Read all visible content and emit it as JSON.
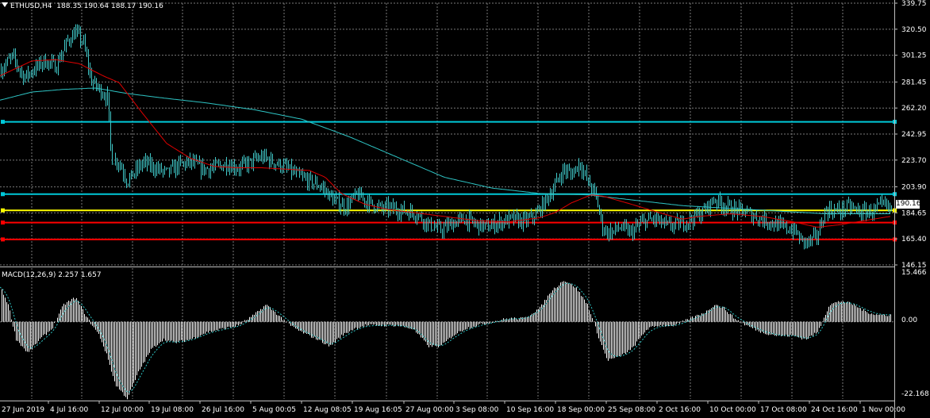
{
  "header": {
    "symbol_tf": "ETHUSD,H4",
    "ohlc": "188.35 190.64 188.17 190.16"
  },
  "current_price": "190.16",
  "price_axis": {
    "ticks": [
      "339.75",
      "320.50",
      "301.25",
      "281.45",
      "262.20",
      "242.95",
      "223.70",
      "203.90",
      "184.65",
      "165.40",
      "146.15"
    ],
    "min": 146.15,
    "max": 339.75
  },
  "time_axis": {
    "labels": [
      "27 Jun 2019",
      "4 Jul 16:00",
      "12 Jul 00:00",
      "19 Jul 08:00",
      "26 Jul 16:00",
      "5 Aug 00:05",
      "12 Aug 08:05",
      "19 Aug 16:05",
      "27 Aug 00:00",
      "3 Sep 08:00",
      "10 Sep 16:00",
      "18 Sep 00:00",
      "25 Sep 08:00",
      "2 Oct 16:00",
      "10 Oct 00:00",
      "17 Oct 08:00",
      "24 Oct 16:00",
      "1 Nov 00:00"
    ]
  },
  "macd": {
    "label": "MACD(12,26,9) 2.257 1.657",
    "ticks": [
      "15.466",
      "0.00",
      "-22.168"
    ],
    "min": -22.168,
    "max": 15.466
  },
  "horizontal_levels": [
    {
      "price": 252.0,
      "color": "#00c8d8"
    },
    {
      "price": 198.5,
      "color": "#00c8d8"
    },
    {
      "price": 186.5,
      "color": "#ffff00"
    },
    {
      "price": 177.5,
      "color": "#ff0000"
    },
    {
      "price": 165.0,
      "color": "#ff0000"
    }
  ],
  "colors": {
    "background": "#000000",
    "grid": "#7a7a7a",
    "candle": "#40c8c8",
    "ma_fast": "#e00000",
    "ma_slow": "#2ec4c4",
    "macd_hist": "#ffffff",
    "macd_signal": "#2ec4c4"
  },
  "chart_data": {
    "type": "candlestick",
    "price_anchors": [
      [
        0,
        290
      ],
      [
        15,
        300
      ],
      [
        30,
        285
      ],
      [
        45,
        292
      ],
      [
        55,
        297
      ],
      [
        70,
        293
      ],
      [
        85,
        312
      ],
      [
        95,
        318
      ],
      [
        105,
        310
      ],
      [
        115,
        282
      ],
      [
        125,
        276
      ],
      [
        135,
        270
      ],
      [
        140,
        225
      ],
      [
        150,
        222
      ],
      [
        160,
        208
      ],
      [
        170,
        215
      ],
      [
        180,
        222
      ],
      [
        195,
        218
      ],
      [
        210,
        214
      ],
      [
        225,
        220
      ],
      [
        240,
        222
      ],
      [
        255,
        217
      ],
      [
        270,
        218
      ],
      [
        285,
        221
      ],
      [
        300,
        218
      ],
      [
        315,
        222
      ],
      [
        330,
        226
      ],
      [
        345,
        222
      ],
      [
        360,
        218
      ],
      [
        375,
        212
      ],
      [
        390,
        208
      ],
      [
        405,
        204
      ],
      [
        420,
        194
      ],
      [
        435,
        189
      ],
      [
        450,
        198
      ],
      [
        465,
        192
      ],
      [
        480,
        188
      ],
      [
        495,
        188
      ],
      [
        510,
        186
      ],
      [
        525,
        184
      ],
      [
        540,
        176
      ],
      [
        555,
        172
      ],
      [
        570,
        177
      ],
      [
        585,
        180
      ],
      [
        600,
        176
      ],
      [
        615,
        174
      ],
      [
        630,
        178
      ],
      [
        645,
        180
      ],
      [
        660,
        178
      ],
      [
        675,
        183
      ],
      [
        690,
        196
      ],
      [
        700,
        206
      ],
      [
        710,
        217
      ],
      [
        720,
        213
      ],
      [
        730,
        222
      ],
      [
        740,
        208
      ],
      [
        750,
        198
      ],
      [
        760,
        172
      ],
      [
        770,
        170
      ],
      [
        780,
        174
      ],
      [
        795,
        170
      ],
      [
        810,
        178
      ],
      [
        825,
        180
      ],
      [
        840,
        175
      ],
      [
        855,
        176
      ],
      [
        870,
        180
      ],
      [
        885,
        185
      ],
      [
        900,
        195
      ],
      [
        912,
        190
      ],
      [
        925,
        187
      ],
      [
        940,
        185
      ],
      [
        955,
        181
      ],
      [
        970,
        178
      ],
      [
        985,
        174
      ],
      [
        1000,
        172
      ],
      [
        1010,
        164
      ],
      [
        1020,
        163
      ],
      [
        1030,
        168
      ],
      [
        1040,
        187
      ],
      [
        1055,
        186
      ],
      [
        1070,
        189
      ],
      [
        1085,
        185
      ],
      [
        1100,
        186
      ],
      [
        1112,
        190
      ],
      [
        1122,
        188
      ]
    ],
    "ma_fast_anchors": [
      [
        0,
        286
      ],
      [
        40,
        297
      ],
      [
        70,
        298
      ],
      [
        100,
        295
      ],
      [
        130,
        286
      ],
      [
        150,
        281
      ],
      [
        180,
        258
      ],
      [
        210,
        236
      ],
      [
        240,
        225
      ],
      [
        270,
        219
      ],
      [
        300,
        218
      ],
      [
        330,
        218
      ],
      [
        360,
        217
      ],
      [
        390,
        216
      ],
      [
        410,
        211
      ],
      [
        430,
        199
      ],
      [
        460,
        191
      ],
      [
        490,
        187
      ],
      [
        520,
        185
      ],
      [
        560,
        182
      ],
      [
        600,
        179
      ],
      [
        640,
        178
      ],
      [
        680,
        181
      ],
      [
        700,
        185
      ],
      [
        720,
        192
      ],
      [
        745,
        198
      ],
      [
        760,
        197
      ],
      [
        790,
        192
      ],
      [
        830,
        185
      ],
      [
        860,
        180
      ],
      [
        880,
        182
      ],
      [
        920,
        184
      ],
      [
        960,
        182
      ],
      [
        1000,
        178
      ],
      [
        1030,
        174
      ],
      [
        1060,
        176
      ],
      [
        1100,
        180
      ],
      [
        1122,
        182
      ]
    ],
    "ma_slow_anchors": [
      [
        0,
        268
      ],
      [
        40,
        274
      ],
      [
        80,
        276
      ],
      [
        120,
        277
      ],
      [
        160,
        273
      ],
      [
        200,
        270
      ],
      [
        260,
        266
      ],
      [
        320,
        261
      ],
      [
        380,
        254
      ],
      [
        440,
        241
      ],
      [
        500,
        226
      ],
      [
        560,
        211
      ],
      [
        620,
        203
      ],
      [
        680,
        199
      ],
      [
        740,
        198
      ],
      [
        800,
        194
      ],
      [
        860,
        190
      ],
      [
        920,
        188
      ],
      [
        980,
        186
      ],
      [
        1040,
        184
      ],
      [
        1100,
        184
      ],
      [
        1122,
        184
      ]
    ],
    "macd_anchors": [
      [
        0,
        10
      ],
      [
        10,
        5
      ],
      [
        20,
        -5
      ],
      [
        35,
        -9
      ],
      [
        50,
        -5
      ],
      [
        65,
        -2
      ],
      [
        80,
        5
      ],
      [
        95,
        7
      ],
      [
        110,
        1
      ],
      [
        125,
        -4
      ],
      [
        135,
        -10
      ],
      [
        145,
        -18
      ],
      [
        160,
        -22
      ],
      [
        175,
        -14
      ],
      [
        190,
        -8
      ],
      [
        205,
        -5
      ],
      [
        220,
        -6
      ],
      [
        240,
        -5
      ],
      [
        260,
        -3
      ],
      [
        280,
        -2
      ],
      [
        300,
        -1
      ],
      [
        320,
        2
      ],
      [
        335,
        5
      ],
      [
        350,
        2
      ],
      [
        365,
        -1
      ],
      [
        380,
        -3
      ],
      [
        400,
        -5
      ],
      [
        415,
        -7
      ],
      [
        430,
        -4
      ],
      [
        445,
        -2
      ],
      [
        460,
        -1
      ],
      [
        480,
        -1
      ],
      [
        500,
        -1
      ],
      [
        520,
        -2
      ],
      [
        540,
        -7
      ],
      [
        555,
        -7
      ],
      [
        570,
        -4
      ],
      [
        585,
        -2
      ],
      [
        600,
        -1
      ],
      [
        620,
        0
      ],
      [
        640,
        1
      ],
      [
        660,
        1
      ],
      [
        680,
        4
      ],
      [
        695,
        9
      ],
      [
        710,
        12
      ],
      [
        725,
        10
      ],
      [
        740,
        5
      ],
      [
        755,
        -5
      ],
      [
        765,
        -11
      ],
      [
        780,
        -10
      ],
      [
        795,
        -8
      ],
      [
        805,
        -5
      ],
      [
        815,
        -2
      ],
      [
        830,
        -1
      ],
      [
        850,
        -1
      ],
      [
        870,
        1
      ],
      [
        890,
        3
      ],
      [
        900,
        5
      ],
      [
        912,
        4
      ],
      [
        925,
        1
      ],
      [
        940,
        -1
      ],
      [
        960,
        -3
      ],
      [
        980,
        -4
      ],
      [
        1000,
        -4
      ],
      [
        1015,
        -5
      ],
      [
        1030,
        -3
      ],
      [
        1045,
        5
      ],
      [
        1060,
        6
      ],
      [
        1075,
        5
      ],
      [
        1090,
        3
      ],
      [
        1105,
        2
      ],
      [
        1122,
        2
      ]
    ]
  }
}
